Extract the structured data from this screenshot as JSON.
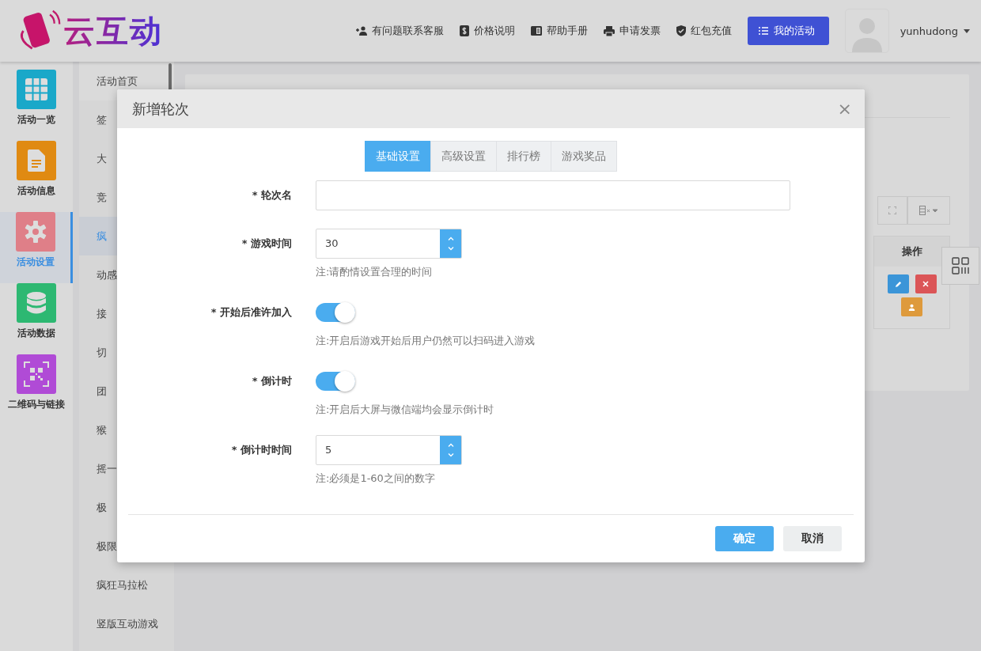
{
  "header": {
    "logo_text": "云互动",
    "links": [
      {
        "label": "有问题联系客服"
      },
      {
        "label": "价格说明"
      },
      {
        "label": "帮助手册"
      },
      {
        "label": "申请发票"
      },
      {
        "label": "红包充值"
      }
    ],
    "primary_button": "我的活动",
    "username": "yunhudong"
  },
  "side_nav": {
    "items": [
      {
        "label": "活动一览",
        "color": "#1aa8c9",
        "selected": false
      },
      {
        "label": "活动信息",
        "color": "#e08a12",
        "selected": false
      },
      {
        "label": "活动设置",
        "color": "#df7f88",
        "selected": true
      },
      {
        "label": "活动数据",
        "color": "#2db872",
        "selected": false
      },
      {
        "label": "二维码与链接",
        "color": "#b04bd6",
        "selected": false
      }
    ]
  },
  "sub_nav": {
    "items": [
      {
        "label": "活动首页",
        "selected": false
      },
      {
        "label": "签",
        "selected": false
      },
      {
        "label": "大",
        "selected": false
      },
      {
        "label": "竞",
        "selected": false
      },
      {
        "label": "疯",
        "selected": true
      },
      {
        "label": "动感",
        "selected": false
      },
      {
        "label": "接",
        "selected": false
      },
      {
        "label": "切",
        "selected": false
      },
      {
        "label": "团",
        "selected": false
      },
      {
        "label": "猴",
        "selected": false
      },
      {
        "label": "摇一",
        "selected": false
      },
      {
        "label": "极",
        "selected": false
      },
      {
        "label": "极限",
        "selected": false
      },
      {
        "label": "疯狂马拉松",
        "selected": false
      },
      {
        "label": "竖版互动游戏",
        "selected": false
      }
    ]
  },
  "background_table": {
    "column_header": "操作"
  },
  "modal": {
    "title": "新增轮次",
    "close": "×",
    "tabs": [
      {
        "label": "基础设置",
        "selected": true
      },
      {
        "label": "高级设置",
        "selected": false
      },
      {
        "label": "排行榜",
        "selected": false
      },
      {
        "label": "游戏奖品",
        "selected": false
      }
    ],
    "fields": [
      {
        "kind": "text",
        "label": "* 轮次名"
      },
      {
        "kind": "number",
        "label": "* 游戏时间",
        "value": "30",
        "note": "注:请酌情设置合理的时间"
      },
      {
        "kind": "switch",
        "label": "* 开始后准许加入",
        "on": true,
        "note": "注:开启后游戏开始后用户仍然可以扫码进入游戏"
      },
      {
        "kind": "switch",
        "label": "* 倒计时",
        "on": true,
        "note": "注:开启后大屏与微信端均会显示倒计时"
      },
      {
        "kind": "number",
        "label": "* 倒计时时间",
        "value": "5",
        "note": "注:必须是1-60之间的数字"
      }
    ],
    "buttons": [
      {
        "label": "确定",
        "kind": "primary"
      },
      {
        "label": "取消",
        "kind": "default"
      }
    ]
  }
}
